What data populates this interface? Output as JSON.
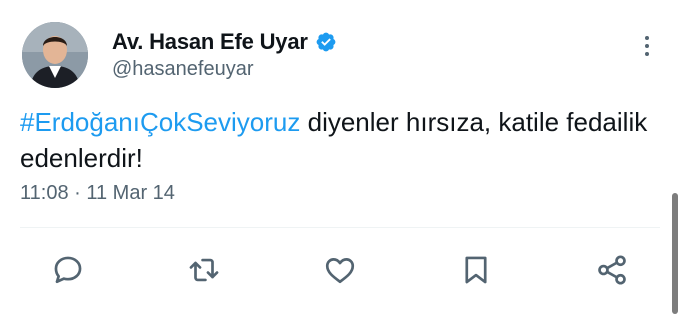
{
  "author": {
    "display_name": "Av. Hasan Efe Uyar",
    "handle": "@hasanefeuyar",
    "verified": true,
    "verified_color": "#1d9bf0"
  },
  "tweet": {
    "hashtag": "#ErdoğanıÇokSeviyoruz",
    "body_rest": " diyenler hırsıza, katile fedailik edenlerdir!",
    "timestamp": "11:08 · 11 Mar 14"
  },
  "actions": [
    {
      "icon": "reply-icon"
    },
    {
      "icon": "retweet-icon"
    },
    {
      "icon": "like-icon"
    },
    {
      "icon": "bookmark-icon"
    },
    {
      "icon": "share-icon"
    }
  ],
  "colors": {
    "link": "#1d9bf0",
    "secondary_text": "#536471",
    "primary_text": "#0f1419"
  }
}
